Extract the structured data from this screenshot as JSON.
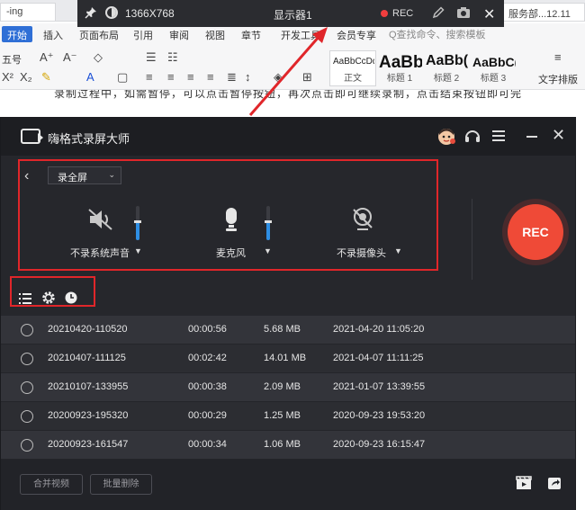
{
  "colors": {
    "accent_blue": "#2e8fe5",
    "rec_red": "#ef4a37",
    "annotation_red": "#e0262a",
    "window_dark": "#222328"
  },
  "background_app": {
    "tabs": {
      "left_tab": "-ing",
      "right_tab": "服务部...12.11"
    },
    "menu": [
      "开始",
      "插入",
      "页面布局",
      "引用",
      "审阅",
      "视图",
      "章节",
      "开发工具",
      "会员专享"
    ],
    "search_placeholder": "Q查找命令、搜索模板",
    "toolbar": {
      "font_size": "五号",
      "style_samples": [
        "AaBbCcDd",
        "AaBb",
        "AaBb(",
        "AaBbC("
      ],
      "style_names": [
        "正文",
        "标题 1",
        "标题 2",
        "标题 3"
      ],
      "text_layout": "文字排版"
    },
    "doc_line": "录制过程中，如需暂停，可以点击暂停按钮，再次点击即可继续录制，点击结束按钮即可完成录制，视频会自动保存。"
  },
  "display_bar": {
    "resolution": "1366X768",
    "display_name": "显示器1",
    "rec_label": "REC",
    "icons": [
      "pin-icon",
      "contrast-icon",
      "pen-icon",
      "camera-icon",
      "close-icon"
    ]
  },
  "recorder": {
    "title": "嗨格式录屏大师",
    "mode": "录全屏",
    "sources": {
      "system_audio": {
        "label": "不录系统声音",
        "level": 0.55,
        "icon": "speaker-muted-icon"
      },
      "microphone": {
        "label": "麦克风",
        "level": 0.55,
        "icon": "microphone-icon"
      },
      "camera": {
        "label": "不录摄像头",
        "icon": "camera-off-icon"
      }
    },
    "rec_button": "REC",
    "recordings": [
      {
        "name": "20210420-110520",
        "duration": "00:00:56",
        "size": "5.68 MB",
        "date": "2021-04-20 11:05:20"
      },
      {
        "name": "20210407-111125",
        "duration": "00:02:42",
        "size": "14.01 MB",
        "date": "2021-04-07 11:11:25"
      },
      {
        "name": "20210107-133955",
        "duration": "00:00:38",
        "size": "2.09 MB",
        "date": "2021-01-07 13:39:55"
      },
      {
        "name": "20200923-195320",
        "duration": "00:00:29",
        "size": "1.25 MB",
        "date": "2020-09-23 19:53:20"
      },
      {
        "name": "20200923-161547",
        "duration": "00:00:34",
        "size": "1.06 MB",
        "date": "2020-09-23 16:15:47"
      }
    ],
    "footer": {
      "merge": "合并视频",
      "batch_delete": "批量删除"
    }
  }
}
